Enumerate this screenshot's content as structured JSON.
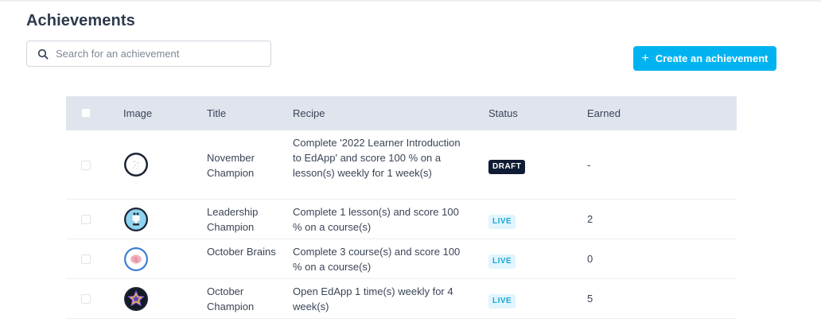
{
  "header": {
    "title": "Achievements"
  },
  "search": {
    "placeholder": "Search for an achievement"
  },
  "actions": {
    "create_label": "Create an achievement",
    "accent": "#00b3f0"
  },
  "table": {
    "columns": [
      "Image",
      "Title",
      "Recipe",
      "Status",
      "Earned"
    ],
    "rows": [
      {
        "image": "dotted-circle-badge",
        "title": "November Champion",
        "recipe": "Complete '2022 Learner Introduction to EdApp' and score 100 % on a lesson(s) weekly for 1 week(s)",
        "status": "DRAFT",
        "earned": "-"
      },
      {
        "image": "trophy-badge",
        "title": "Leadership Champion",
        "recipe": "Complete 1 lesson(s) and score 100 % on a course(s)",
        "status": "LIVE",
        "earned": "2"
      },
      {
        "image": "brain-badge",
        "title": "October Brains",
        "recipe": "Complete 3 course(s) and score 100 % on a course(s)",
        "status": "LIVE",
        "earned": "0"
      },
      {
        "image": "star-badge",
        "title": "October Champion",
        "recipe": "Open EdApp 1 time(s) weekly for 4 week(s)",
        "status": "LIVE",
        "earned": "5"
      }
    ]
  },
  "colors": {
    "header_bg": "#dfe4ed",
    "draft": "#0f1c33",
    "live_text": "#1da7da",
    "live_bg": "#e1f5fd"
  }
}
